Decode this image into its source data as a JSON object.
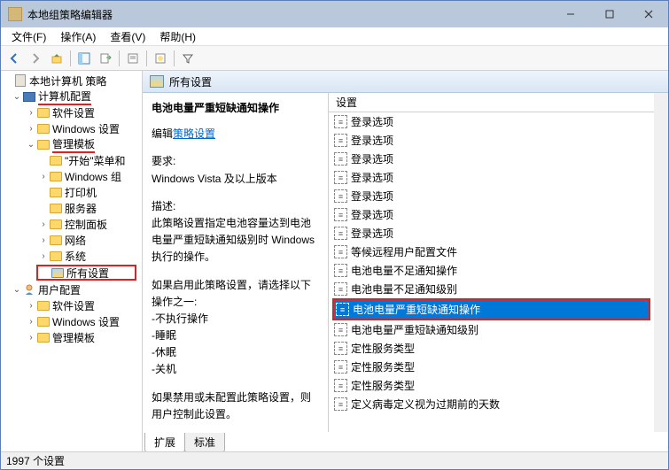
{
  "window": {
    "title": "本地组策略编辑器"
  },
  "menu": {
    "file": "文件(F)",
    "action": "操作(A)",
    "view": "查看(V)",
    "help": "帮助(H)"
  },
  "tree": {
    "root": "本地计算机 策略",
    "computer_config": "计算机配置",
    "software_settings": "软件设置",
    "windows_settings": "Windows 设置",
    "admin_templates": "管理模板",
    "start_menu": "\"开始\"菜单和",
    "windows_comp": "Windows 组",
    "printers": "打印机",
    "servers": "服务器",
    "control_panel": "控制面板",
    "network": "网络",
    "system": "系统",
    "all_settings": "所有设置",
    "user_config": "用户配置",
    "software_settings2": "软件设置",
    "windows_settings2": "Windows 设置",
    "admin_templates2": "管理模板"
  },
  "header": {
    "title": "所有设置"
  },
  "desc": {
    "title": "电池电量严重短缺通知操作",
    "edit_prefix": "编辑",
    "edit_link": "策略设置",
    "req_label": "要求:",
    "req_text": "Windows Vista 及以上版本",
    "desc_label": "描述:",
    "desc_text": "此策略设置指定电池容量达到电池电量严重短缺通知级别时 Windows 执行的操作。",
    "enable_text": "如果启用此策略设置，请选择以下操作之一:",
    "opt1": "-不执行操作",
    "opt2": "-睡眠",
    "opt3": "-休眠",
    "opt4": "-关机",
    "disable_text": "如果禁用或未配置此策略设置，则用户控制此设置。"
  },
  "list": {
    "header": "设置",
    "items": [
      "登录选项",
      "登录选项",
      "登录选项",
      "登录选项",
      "登录选项",
      "登录选项",
      "登录选项",
      "等候远程用户配置文件",
      "电池电量不足通知操作",
      "电池电量不足通知级别",
      "电池电量严重短缺通知操作",
      "电池电量严重短缺通知级别",
      "定性服务类型",
      "定性服务类型",
      "定性服务类型",
      "定义病毒定义视为过期前的天数"
    ],
    "selected_index": 10
  },
  "tabs": {
    "extended": "扩展",
    "standard": "标准"
  },
  "status": {
    "count": "1997 个设置"
  }
}
